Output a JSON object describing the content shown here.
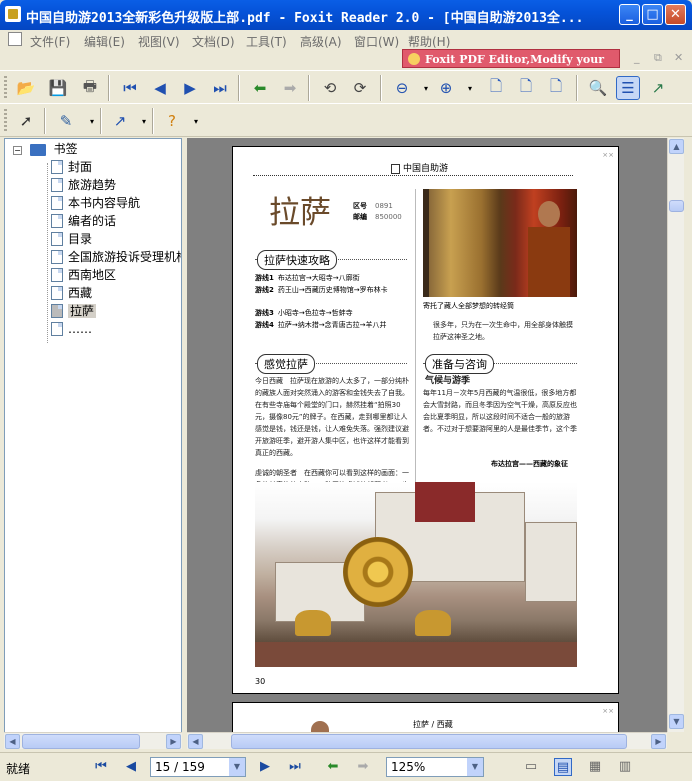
{
  "window": {
    "title": "中国自助游2013全新彩色升级版上部.pdf - Foxit Reader 2.0 - [中国自助游2013全...",
    "minimize": "_",
    "maximize": "□",
    "close": "✕"
  },
  "menu": {
    "items": [
      "文件(F)",
      "编辑(E)",
      "视图(V)",
      "文档(D)",
      "工具(T)",
      "高级(A)",
      "窗口(W)",
      "帮助(H)"
    ],
    "ad_banner": "Foxit PDF Editor,Modify your PDF!",
    "mdi_buttons": [
      "_",
      "⧉",
      "✕"
    ]
  },
  "bookmarks": {
    "root": "书签",
    "items": [
      "封面",
      "旅游趋势",
      "本书内容导航",
      "编者的话",
      "目录",
      "全国旅游投诉受理机构",
      "西南地区",
      "西藏",
      "拉萨",
      "……"
    ],
    "selected_index": 8
  },
  "page": {
    "header": "中国自助游",
    "title": "拉萨",
    "meta": [
      {
        "label": "区号",
        "value": "0891"
      },
      {
        "label": "邮编",
        "value": "850000"
      }
    ],
    "photo_caption": "寄托了藏人全部梦想的转经筒",
    "quick_title": "拉萨快速攻略",
    "routes": [
      {
        "label": "游线1",
        "text": "布达拉宫→大昭寺→八廓街"
      },
      {
        "label": "游线2",
        "text": "药王山→西藏历史博物馆→罗布林卡"
      },
      {
        "label": "游线3",
        "text": "小昭寺→色拉寺→哲蚌寺"
      },
      {
        "label": "游线4",
        "text": "拉萨→纳木措→念青唐古拉→羊八井"
      }
    ],
    "right_para": "很多年，只为在一次生命中，用全部身体触摸拉萨这神圣之地。",
    "feel_title": "感觉拉萨",
    "feel_para": "今日西藏　拉萨现在旅游的人太多了，一部分纯朴的藏族人面对突然涌入的游客和金钱失去了自我。在有些寺庙每个殿堂的门口，赫然挂着“拍照30元，摄像80元”的牌子。在西藏，走到哪里都让人感觉是钱，钱还是钱，让人难免失落。强烈建议避开旅游旺季，避开游人集中区，也许这样才能看到真正的西藏。",
    "pilgrim_para": "虔诚的朝圣者　在西藏你可以看到这样的画面：一条悠长奇绝的山路，一队无比虔诚的朝拜者，一步一叩首。每一步都是表达对佛的虔诚。他们已经走了",
    "prep_title": "准备与咨询",
    "climate_title": "气候与游季",
    "climate_para": "每年11月－次年5月西藏的气温很低，很多地方都会大雪封路，而且冬季因为空气干燥，高原反应也会比夏季明显，所以这段时间不适合一般的旅游者。不过对于想要游阿里的人是最佳季节，这个季",
    "photo2_caption": "布达拉宫——西藏的象征",
    "page_number": "30",
    "page2_header": "拉萨 / 西藏"
  },
  "status": {
    "ready": "就绪",
    "page_field": "15 / 159",
    "zoom_field": "125%"
  },
  "colors": {
    "titlebar": "#0553d9",
    "doc_bg": "#808080",
    "ad_banner": "#e05a6c",
    "page_title": "#6a4a2a"
  }
}
